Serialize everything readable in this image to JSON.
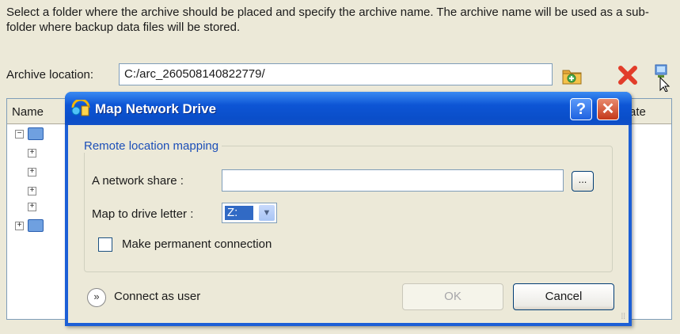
{
  "instructions": "Select a folder where the archive should be placed and specify the archive name. The archive name will be used as a sub-folder where backup data files will be stored.",
  "archive_location": {
    "label": "Archive location:",
    "value": "C:/arc_260508140822779/"
  },
  "toolbar": {
    "icons": [
      "new-folder-icon",
      "delete-icon",
      "network-drive-icon"
    ]
  },
  "list": {
    "columns": [
      "Name",
      "ate"
    ]
  },
  "dialog": {
    "title": "Map Network Drive",
    "help_label": "?",
    "close_label": "✕",
    "group_title": "Remote location mapping",
    "share_label": "A network share   :",
    "share_value": "",
    "browse_label": "...",
    "drive_label": "Map to drive letter :",
    "drive_value": "Z:",
    "permanent_label": "Make permanent connection",
    "permanent_checked": false,
    "connect_label": "Connect as user",
    "ok_label": "OK",
    "cancel_label": "Cancel"
  },
  "colors": {
    "titlebar": "#0a4ec9",
    "face": "#ece9d8",
    "group_title": "#1c4fb8",
    "selection": "#316ac5"
  }
}
